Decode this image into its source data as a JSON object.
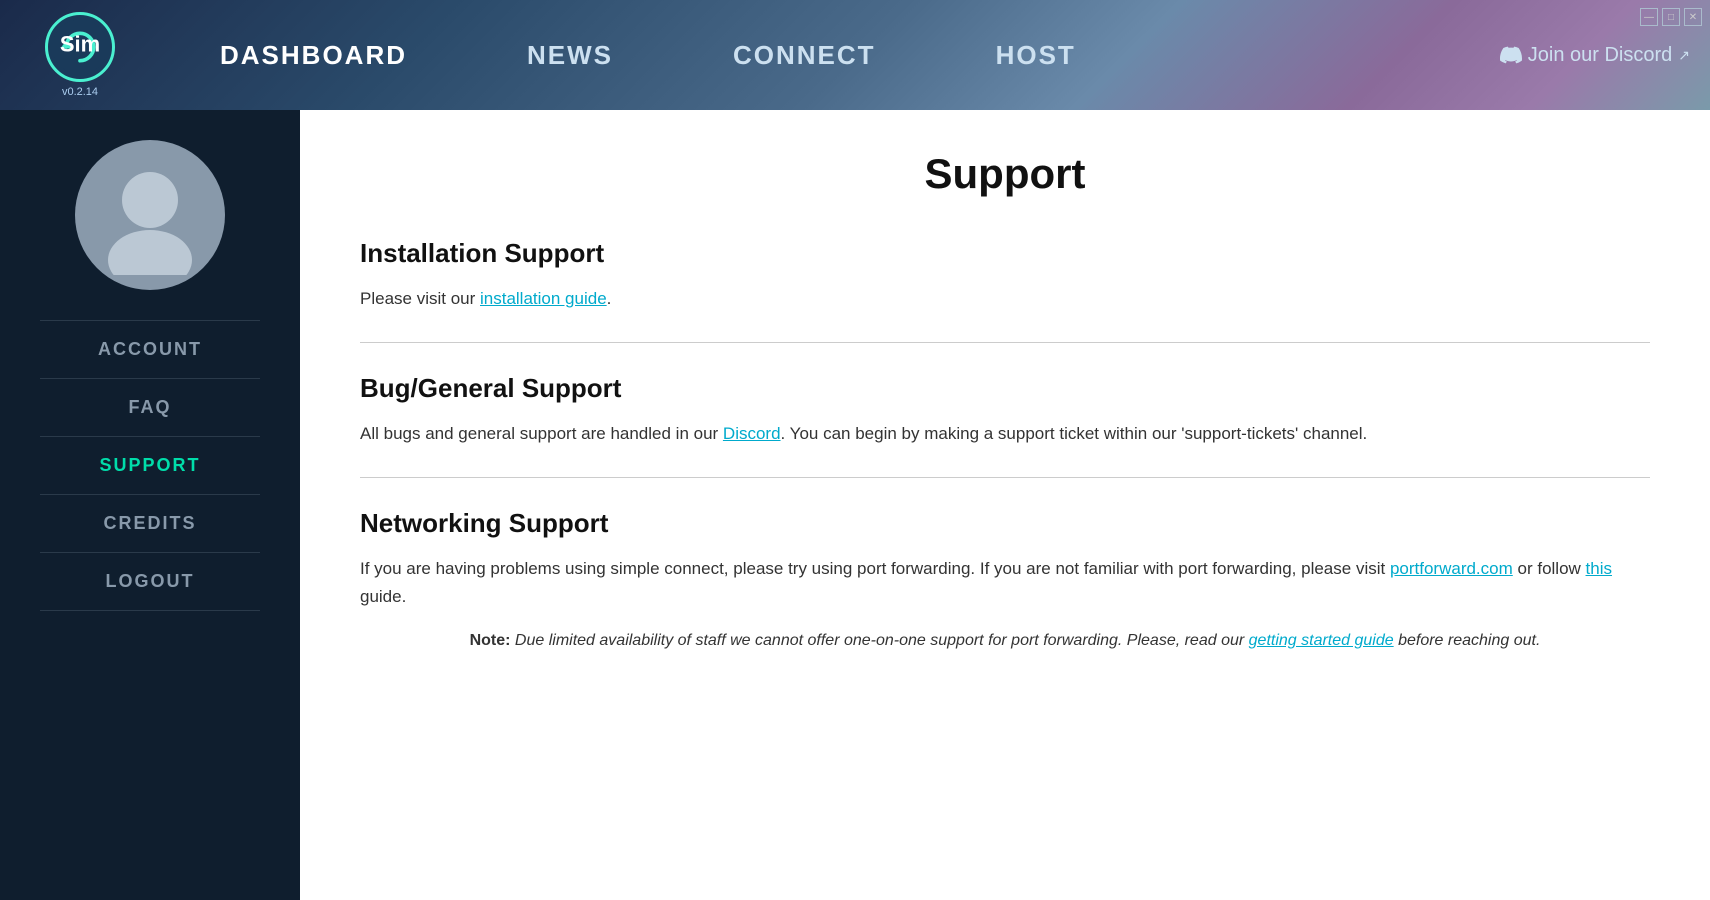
{
  "app": {
    "version": "v0.2.14"
  },
  "header": {
    "nav_items": [
      {
        "id": "dashboard",
        "label": "DASHBOARD",
        "active": true
      },
      {
        "id": "news",
        "label": "NEWS",
        "active": false
      },
      {
        "id": "connect",
        "label": "CONNECT",
        "active": false
      },
      {
        "id": "host",
        "label": "HOST",
        "active": false
      }
    ],
    "discord_link": "Join our Discord",
    "window_min": "—",
    "window_max": "□",
    "window_close": "✕"
  },
  "sidebar": {
    "items": [
      {
        "id": "account",
        "label": "ACCOUNT",
        "active": false
      },
      {
        "id": "faq",
        "label": "FAQ",
        "active": false
      },
      {
        "id": "support",
        "label": "SUPPORT",
        "active": true
      },
      {
        "id": "credits",
        "label": "CREDITS",
        "active": false
      },
      {
        "id": "logout",
        "label": "LOGOUT",
        "active": false
      }
    ]
  },
  "content": {
    "page_title": "Support",
    "sections": [
      {
        "id": "installation",
        "title": "Installation Support",
        "text_before": "Please visit our ",
        "link_text": "installation guide",
        "link_href": "#",
        "text_after": "."
      },
      {
        "id": "bug",
        "title": "Bug/General Support",
        "text_before": "All bugs and general support are handled in our ",
        "link_text": "Discord",
        "link_href": "#",
        "text_after": ". You can begin by making a support ticket within our 'support-tickets' channel."
      },
      {
        "id": "networking",
        "title": "Networking Support",
        "text_main": "If you are having problems using simple connect, please try using port forwarding. If you are not familiar with port forwarding, please visit ",
        "link1_text": "portforward.com",
        "link1_href": "#",
        "text_mid": " or follow ",
        "link2_text": "this",
        "link2_href": "#",
        "text_end": " guide.",
        "note_prefix": "Note:",
        "note_text": " Due limited availability of staff we cannot offer one-on-one support for port forwarding. Please, read our ",
        "note_link_text": "getting started guide",
        "note_link_href": "#",
        "note_text_end": " before reaching out."
      }
    ]
  }
}
